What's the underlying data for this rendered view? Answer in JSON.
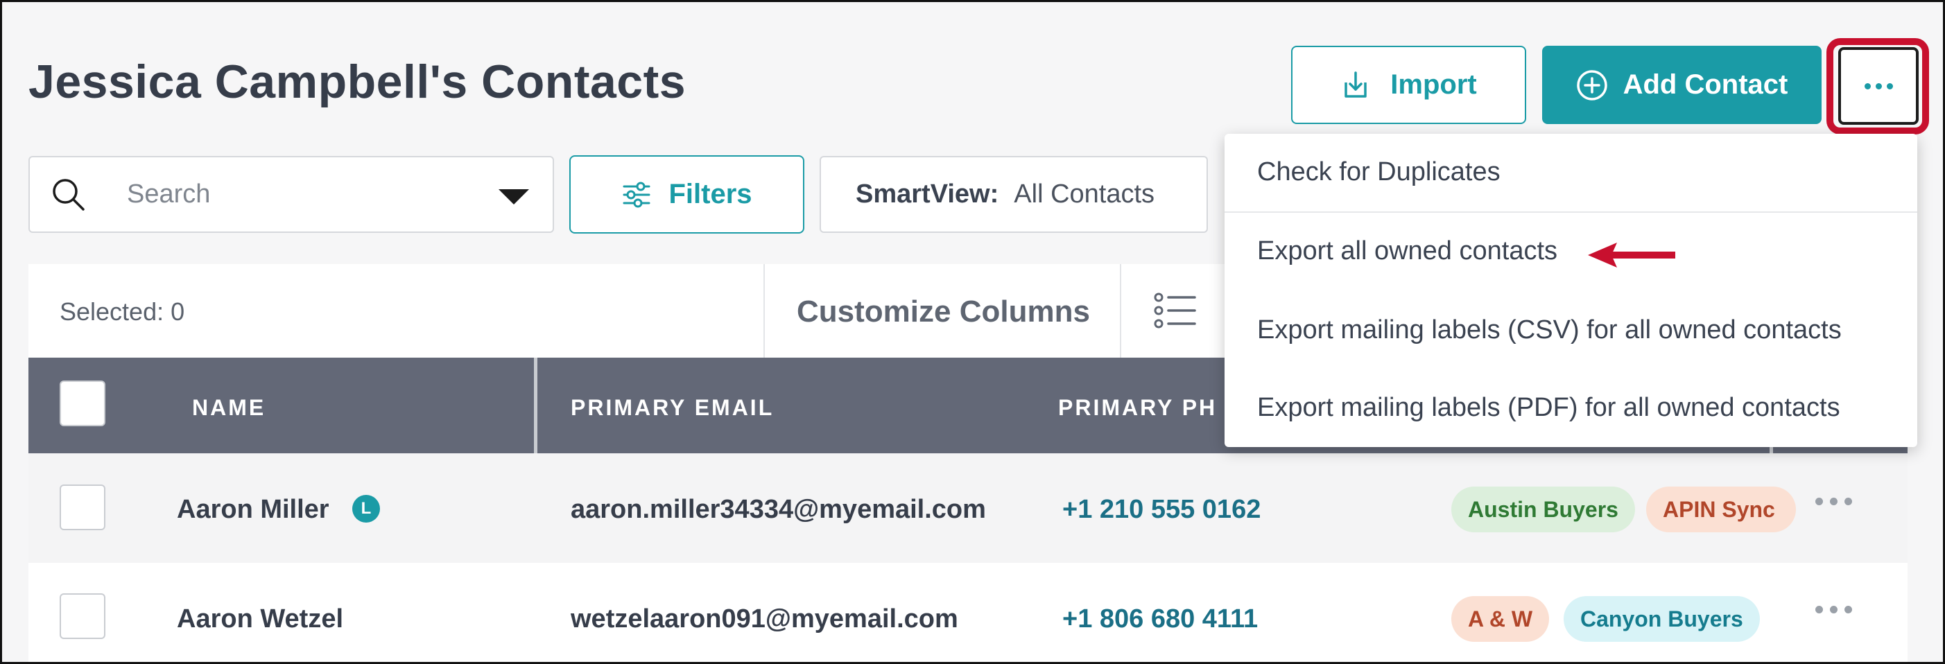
{
  "header": {
    "title": "Jessica Campbell's Contacts",
    "import_label": "Import",
    "add_contact_label": "Add Contact"
  },
  "search": {
    "placeholder": "Search"
  },
  "filters": {
    "label": "Filters"
  },
  "smartview": {
    "label": "SmartView:",
    "value": "All Contacts"
  },
  "toolbar": {
    "selected": "Selected: 0",
    "customize_columns": "Customize Columns"
  },
  "table": {
    "columns": [
      "NAME",
      "PRIMARY EMAIL",
      "PRIMARY PH"
    ],
    "rows": [
      {
        "name": "Aaron Miller",
        "badge": "L",
        "email": "aaron.miller34334@myemail.com",
        "phone": "+1 210 555 0162",
        "tags": [
          "Austin Buyers",
          "APIN Sync"
        ]
      },
      {
        "name": "Aaron Wetzel",
        "email": "wetzelaaron091@myemail.com",
        "phone": "+1 806 680 4111",
        "tags": [
          "A & W",
          "Canyon Buyers"
        ]
      }
    ]
  },
  "menu": {
    "items": [
      "Check for Duplicates",
      "Export all owned contacts",
      "Export mailing labels (CSV) for all owned contacts",
      "Export mailing labels (PDF) for all owned contacts"
    ]
  },
  "colors": {
    "accent": "#1a9ba6",
    "highlight": "#c8102e",
    "header_bg": "#636877"
  }
}
